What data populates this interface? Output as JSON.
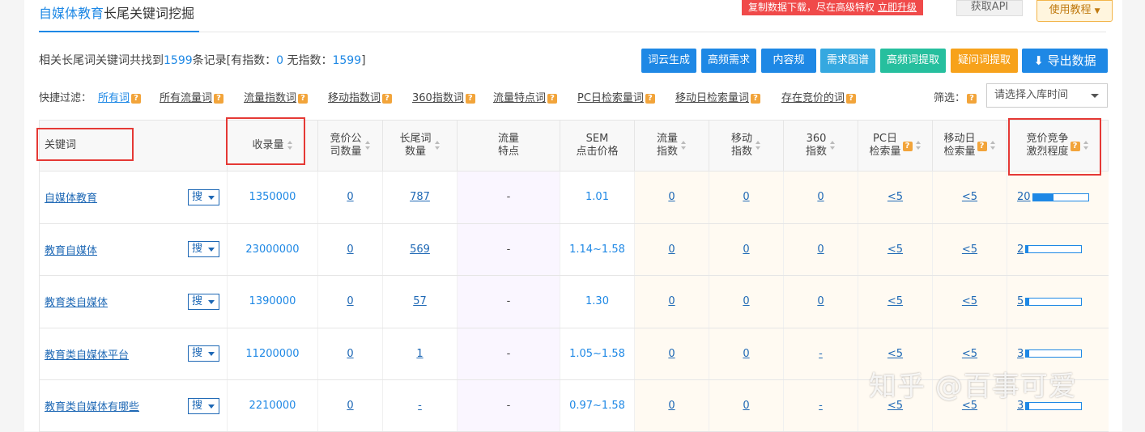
{
  "header": {
    "title_highlight": "自媒体教育",
    "title_rest": "长尾关键词挖掘",
    "promo_text": "复制数据下载，尽在高级特权",
    "promo_link": "立即升级",
    "api_button": "获取API",
    "usage_button": "使用教程"
  },
  "summary": {
    "prefix": "相关长尾词关键词共找到",
    "total": "1599",
    "mid": "条记录[有指数：",
    "with_index": "0",
    "mid2": " 无指数：",
    "without_index": "1599",
    "suffix": "]"
  },
  "actions": [
    {
      "label": "词云生成",
      "color": "#1e88e5"
    },
    {
      "label": "高频需求",
      "color": "#1e88e5"
    },
    {
      "label": "内容规",
      "color": "#1e88e5"
    },
    {
      "label": "需求图谱",
      "color": "#35a8e0"
    },
    {
      "label": "高频词提取",
      "color": "#26bf9e"
    },
    {
      "label": "疑问词提取",
      "color": "#f7a21b"
    },
    {
      "label": "导出数据",
      "color": "#1e88e5"
    }
  ],
  "filters": {
    "label": "快捷过滤：",
    "items": [
      "所有词",
      "所有流量词",
      "流量指数词",
      "移动指数词",
      "360指数词",
      "流量特点词",
      "PC日检索量词",
      "移动日检索量词",
      "存在竞价的词"
    ],
    "screen_label": "筛选：",
    "time_select": "请选择入库时间"
  },
  "table": {
    "headers": [
      "关键词",
      "收录量",
      "竞价公\n司数量",
      "长尾词\n数量",
      "流量\n特点",
      "SEM\n点击价格",
      "流量\n指数",
      "移动\n指数",
      "360\n指数",
      "PC日\n检索量",
      "移动日\n检索量",
      "竞价竞争\n激烈程度"
    ],
    "search_button": "搜",
    "rows": [
      {
        "keyword": "自媒体教育",
        "indexed": "1350000",
        "bid_companies": "0",
        "longtail": "787",
        "traffic_feature": "-",
        "sem_price": "1.01",
        "traffic_index": "0",
        "mobile_index": "0",
        "index_360": "0",
        "pc_daily": "<5",
        "mobile_daily": "<5",
        "competition": "20",
        "competition_level": 0.38
      },
      {
        "keyword": "教育自媒体",
        "indexed": "23000000",
        "bid_companies": "0",
        "longtail": "569",
        "traffic_feature": "-",
        "sem_price": "1.14~1.58",
        "traffic_index": "0",
        "mobile_index": "0",
        "index_360": "0",
        "pc_daily": "<5",
        "mobile_daily": "<5",
        "competition": "2",
        "competition_level": 0.04
      },
      {
        "keyword": "教育类自媒体",
        "indexed": "1390000",
        "bid_companies": "0",
        "longtail": "57",
        "traffic_feature": "-",
        "sem_price": "1.30",
        "traffic_index": "0",
        "mobile_index": "0",
        "index_360": "0",
        "pc_daily": "<5",
        "mobile_daily": "<5",
        "competition": "5",
        "competition_level": 0.06
      },
      {
        "keyword": "教育类自媒体平台",
        "indexed": "11200000",
        "bid_companies": "0",
        "longtail": "1",
        "traffic_feature": "-",
        "sem_price": "1.05~1.58",
        "traffic_index": "0",
        "mobile_index": "0",
        "index_360": "-",
        "pc_daily": "<5",
        "mobile_daily": "<5",
        "competition": "3",
        "competition_level": 0.06
      },
      {
        "keyword": "教育类自媒体有哪些",
        "indexed": "2210000",
        "bid_companies": "0",
        "longtail": "-",
        "traffic_feature": "-",
        "sem_price": "0.97~1.58",
        "traffic_index": "0",
        "mobile_index": "0",
        "index_360": "-",
        "pc_daily": "<5",
        "mobile_daily": "<5",
        "competition": "3",
        "competition_level": 0.06
      }
    ]
  },
  "watermark": "知乎 @百事可爱"
}
